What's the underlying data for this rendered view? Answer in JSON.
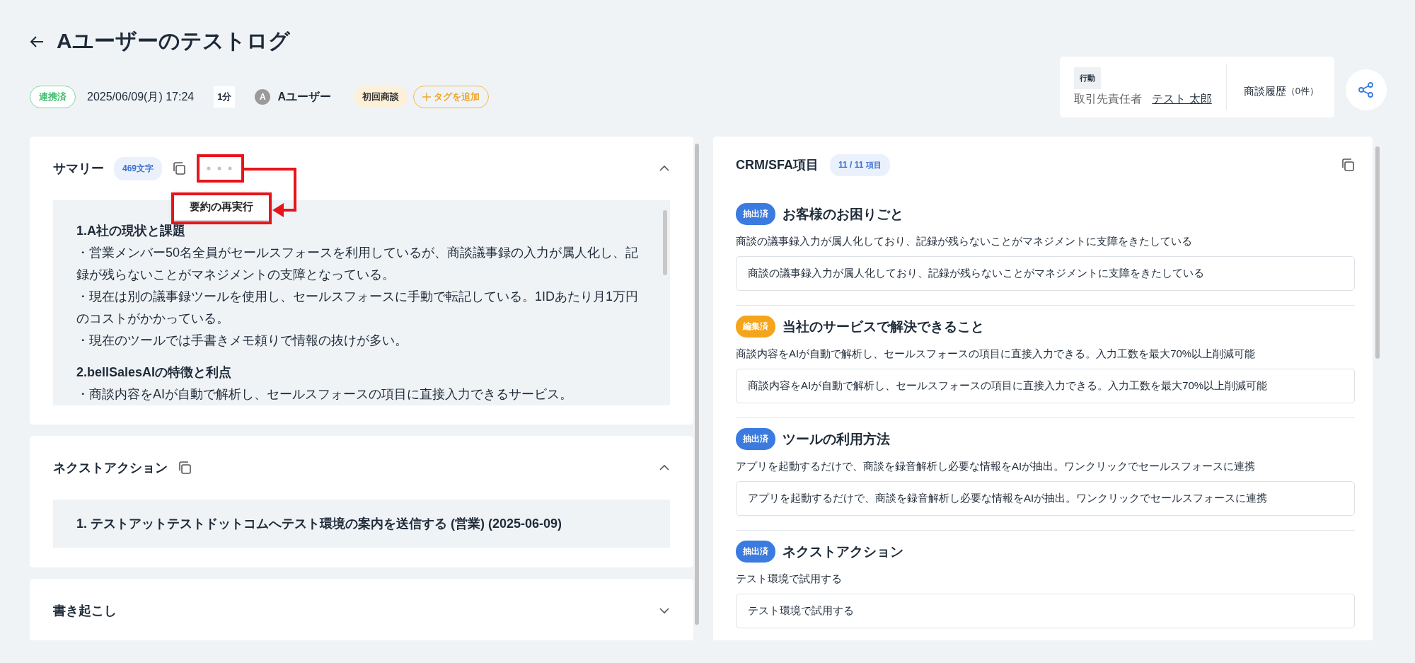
{
  "header": {
    "title": "Aユーザーのテストログ"
  },
  "meta": {
    "status": "連携済",
    "datetime": "2025/06/09(月) 17:24",
    "duration": "1分",
    "user_initial": "A",
    "user_name": "Aユーザー",
    "tags": [
      "初回商談"
    ],
    "add_tag": "タグを追加"
  },
  "info_box": {
    "action_label": "行動",
    "contact_label": "取引先責任者",
    "contact_name": "テスト 太郎",
    "history": "商談履歴",
    "history_count": "（0件）"
  },
  "summary": {
    "title": "サマリー",
    "count": "469文字",
    "expanded": true,
    "menu_item": "要約の再実行",
    "sections": [
      {
        "heading": "1.A社の現状と課題",
        "lines": [
          "・営業メンバー50名全員がセールスフォースを利用しているが、商談議事録の入力が属人化し、記録が残らないことがマネジメントの支障となっている。",
          "・現在は別の議事録ツールを使用し、セールスフォースに手動で転記している。1IDあたり月1万円のコストがかかっている。",
          "・現在のツールでは手書きメモ頼りで情報の抜けが多い。"
        ]
      },
      {
        "heading": "2.bellSalesAIの特徴と利点",
        "lines": [
          "・商談内容をAIが自動で解析し、セールスフォースの項目に直接入力できるサービス。"
        ]
      }
    ]
  },
  "next_action": {
    "title": "ネクストアクション",
    "expanded": true,
    "items": [
      "1. テストアットテストドットコムへテスト環境の案内を送信する (営業) (2025-06-09)"
    ]
  },
  "transcript": {
    "title": "書き起こし",
    "expanded": false
  },
  "crm": {
    "title": "CRM/SFA項目",
    "count": "11 / 11",
    "count_unit": "項目",
    "fields": [
      {
        "badge": "抽出済",
        "color": "#3b7be0",
        "label": "お客様のお困りごと",
        "extracted": "商談の議事録入力が属人化しており、記録が残らないことがマネジメントに支障をきたしている",
        "value": "商談の議事録入力が属人化しており、記録が残らないことがマネジメントに支障をきたしている"
      },
      {
        "badge": "編集済",
        "color": "#f5a51c",
        "label": "当社のサービスで解決できること",
        "extracted": "商談内容をAIが自動で解析し、セールスフォースの項目に直接入力できる。入力工数を最大70%以上削減可能",
        "value": "商談内容をAIが自動で解析し、セールスフォースの項目に直接入力できる。入力工数を最大70%以上削減可能"
      },
      {
        "badge": "抽出済",
        "color": "#3b7be0",
        "label": "ツールの利用方法",
        "extracted": "アプリを起動するだけで、商談を録音解析し必要な情報をAIが抽出。ワンクリックでセールスフォースに連携",
        "value": "アプリを起動するだけで、商談を録音解析し必要な情報をAIが抽出。ワンクリックでセールスフォースに連携"
      },
      {
        "badge": "抽出済",
        "color": "#3b7be0",
        "label": "ネクストアクション",
        "extracted": "テスト環境で試用する",
        "value": "テスト環境で試用する"
      }
    ]
  }
}
